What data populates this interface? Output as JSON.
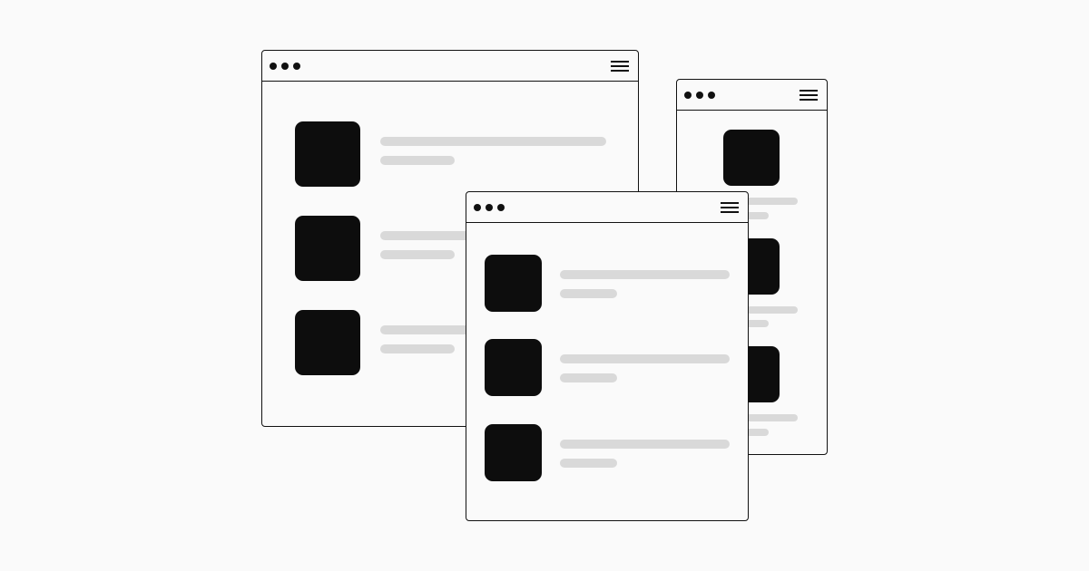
{
  "scene": {
    "background_color": "#fafafa",
    "frame_color": "#111111",
    "placeholder_block_color": "#0d0d0d",
    "placeholder_line_color": "#d9d9d9",
    "windows": [
      {
        "name": "desktop-window",
        "titlebar_icons": [
          "window-dots-icon",
          "hamburger-menu-icon"
        ],
        "item_count": 3
      },
      {
        "name": "mobile-window",
        "titlebar_icons": [
          "window-dots-icon",
          "hamburger-menu-icon"
        ],
        "item_count": 3
      },
      {
        "name": "tablet-window",
        "titlebar_icons": [
          "window-dots-icon",
          "hamburger-menu-icon"
        ],
        "item_count": 3
      }
    ]
  }
}
